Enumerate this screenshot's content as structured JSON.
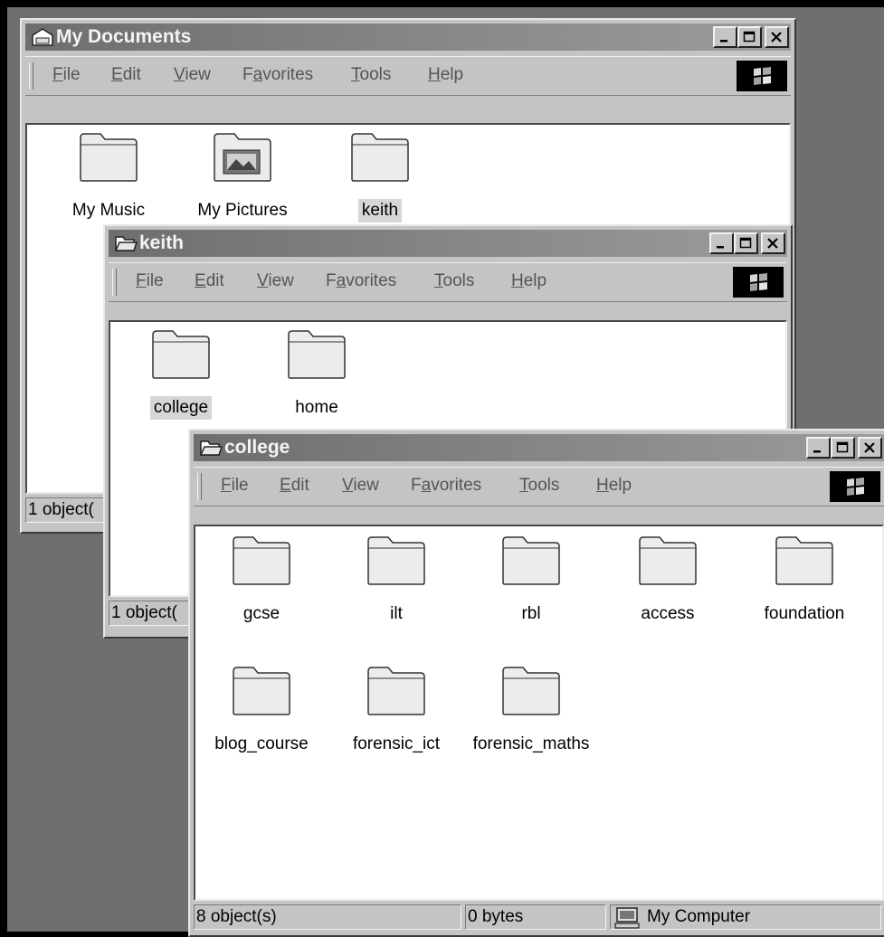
{
  "menu": {
    "file": {
      "u": "F",
      "rest": "ile"
    },
    "edit": {
      "u": "E",
      "rest": "dit"
    },
    "view": {
      "u": "V",
      "rest": "iew"
    },
    "favorites": {
      "pre": "F",
      "u": "a",
      "rest": "vorites"
    },
    "tools": {
      "u": "T",
      "rest": "ools"
    },
    "help": {
      "u": "H",
      "rest": "elp"
    }
  },
  "windows": {
    "my_documents": {
      "title": "My Documents",
      "items": [
        {
          "label": "My Music",
          "icon": "folder-icon"
        },
        {
          "label": "My Pictures",
          "icon": "pictures-folder-icon"
        },
        {
          "label": "keith",
          "icon": "folder-icon",
          "selected": true
        }
      ],
      "status": "1 object("
    },
    "keith": {
      "title": "keith",
      "items": [
        {
          "label": "college",
          "icon": "folder-icon",
          "selected": true
        },
        {
          "label": "home",
          "icon": "folder-icon"
        }
      ],
      "status": "1 object("
    },
    "college": {
      "title": "college",
      "items": [
        {
          "label": "gcse"
        },
        {
          "label": "ilt"
        },
        {
          "label": "rbl"
        },
        {
          "label": "access"
        },
        {
          "label": "foundation"
        },
        {
          "label": "blog_course"
        },
        {
          "label": "forensic_ict"
        },
        {
          "label": "forensic_maths"
        }
      ],
      "status": {
        "count": "8 object(s)",
        "size": "0 bytes",
        "location": "My Computer"
      }
    }
  },
  "colors": {
    "desktop": "#6f6f6f",
    "window_face": "#c4c4c4",
    "selection": "#d6d6d6"
  }
}
